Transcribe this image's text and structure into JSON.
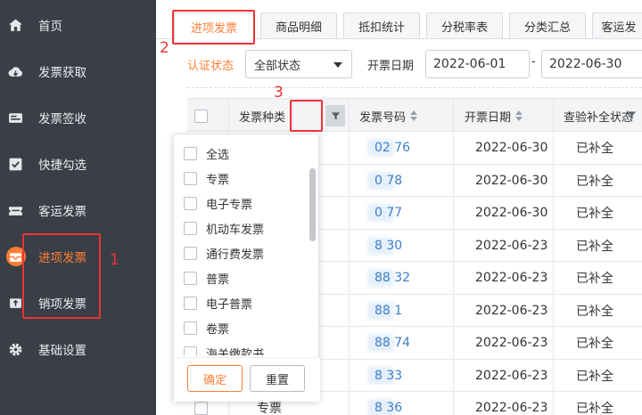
{
  "sidebar": {
    "items": [
      {
        "label": "首页",
        "icon": "home-icon"
      },
      {
        "label": "发票获取",
        "icon": "cloud-download-icon"
      },
      {
        "label": "发票签收",
        "icon": "receipt-sign-icon"
      },
      {
        "label": "快捷勾选",
        "icon": "check-square-icon"
      },
      {
        "label": "客运发票",
        "icon": "ticket-icon"
      },
      {
        "label": "进项发票",
        "icon": "inbox-invoice-icon",
        "active": true
      },
      {
        "label": "销项发票",
        "icon": "outbox-invoice-icon"
      },
      {
        "label": "基础设置",
        "icon": "gear-icon"
      }
    ]
  },
  "tabs": [
    {
      "label": "进项发票",
      "active": true
    },
    {
      "label": "商品明细"
    },
    {
      "label": "抵扣统计"
    },
    {
      "label": "分税率表"
    },
    {
      "label": "分类汇总"
    },
    {
      "label": "客运发"
    }
  ],
  "filters": {
    "auth_status_label": "认证状态",
    "auth_status_value": "全部状态",
    "invoice_date_label": "开票日期",
    "date_from": "2022-06-01",
    "date_sep": "-",
    "date_to": "2022-06-30"
  },
  "table": {
    "headers": {
      "type": "发票种类",
      "number": "发票号码",
      "date": "开票日期",
      "check_status": "查验补全状态"
    },
    "rows": [
      {
        "number": "02  76",
        "date": "2022-06-30",
        "status": "已补全"
      },
      {
        "number": "0  78",
        "date": "2022-06-30",
        "status": "已补全"
      },
      {
        "number": "0  77",
        "date": "2022-06-30",
        "status": "已补全"
      },
      {
        "number": "8  30",
        "date": "2022-06-23",
        "status": "已补全"
      },
      {
        "number": "88  32",
        "date": "2022-06-23",
        "status": "已补全"
      },
      {
        "number": "88  1",
        "date": "2022-06-23",
        "status": "已补全"
      },
      {
        "number": "88  74",
        "date": "2022-06-23",
        "status": "已补全"
      },
      {
        "number": "8  33",
        "date": "2022-06-23",
        "status": "已补全"
      },
      {
        "number": "8  36",
        "date": "2022-06-23",
        "status": "已补全",
        "type": "专票"
      }
    ]
  },
  "filter_dropdown": {
    "options": [
      "全选",
      "专票",
      "电子专票",
      "机动车发票",
      "通行费发票",
      "普票",
      "电子普票",
      "卷票",
      "海关缴款书"
    ],
    "confirm_label": "确定",
    "reset_label": "重置"
  },
  "annotations": {
    "n1": "1",
    "n2": "2",
    "n3": "3",
    "color": "#e33333"
  },
  "colors": {
    "accent": "#ff7e36",
    "sidebar_bg": "#3a3f47",
    "link": "#3d7fc7"
  }
}
